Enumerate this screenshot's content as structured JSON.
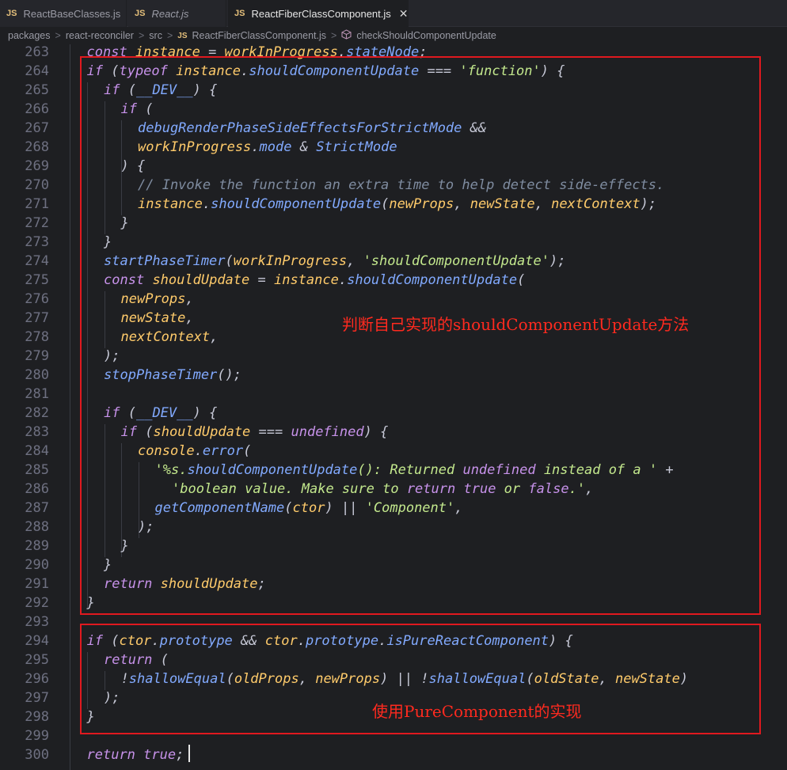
{
  "tabs": [
    {
      "badge": "JS",
      "label": "ReactBaseClasses.js"
    },
    {
      "badge": "JS",
      "label": "React.js"
    },
    {
      "badge": "JS",
      "label": "ReactFiberClassComponent.js",
      "close": "✕"
    }
  ],
  "breadcrumb": {
    "items": [
      "packages",
      "react-reconciler",
      "src"
    ],
    "file_badge": "JS",
    "file": "ReactFiberClassComponent.js",
    "symbol": "checkShouldComponentUpdate",
    "separator": ">"
  },
  "line_numbers": [
    "263",
    "264",
    "265",
    "266",
    "267",
    "268",
    "269",
    "270",
    "271",
    "272",
    "273",
    "274",
    "275",
    "276",
    "277",
    "278",
    "279",
    "280",
    "281",
    "282",
    "283",
    "284",
    "285",
    "286",
    "287",
    "288",
    "289",
    "290",
    "291",
    "292",
    "293",
    "294",
    "295",
    "296",
    "297",
    "298",
    "299",
    "300"
  ],
  "annotations": {
    "note1": "判断自己实现的shouldComponentUpdate方法",
    "note2": "使用PureComponent的实现"
  },
  "colors": {
    "annotation": "#e0191f",
    "background": "#1e1f22"
  },
  "code": [
    [
      "const instance = workInProgress.stateNode;"
    ],
    [
      "if (typeof instance.shouldComponentUpdate === 'function') {"
    ],
    [
      "if (__DEV__) {"
    ],
    [
      "if ("
    ],
    [
      "debugRenderPhaseSideEffectsForStrictMode &&"
    ],
    [
      "workInProgress.mode & StrictMode"
    ],
    [
      ") {"
    ],
    [
      "// Invoke the function an extra time to help detect side-effects."
    ],
    [
      "instance.shouldComponentUpdate(newProps, newState, nextContext);"
    ],
    [
      "}"
    ],
    [
      "}"
    ],
    [
      "startPhaseTimer(workInProgress, 'shouldComponentUpdate');"
    ],
    [
      "const shouldUpdate = instance.shouldComponentUpdate("
    ],
    [
      "newProps,"
    ],
    [
      "newState,"
    ],
    [
      "nextContext,"
    ],
    [
      ");"
    ],
    [
      "stopPhaseTimer();"
    ],
    [
      ""
    ],
    [
      "if (__DEV__) {"
    ],
    [
      "if (shouldUpdate === undefined) {"
    ],
    [
      "console.error("
    ],
    [
      "'%s.shouldComponentUpdate(): Returned undefined instead of a ' +"
    ],
    [
      "'boolean value. Make sure to return true or false.',"
    ],
    [
      "getComponentName(ctor) || 'Component',"
    ],
    [
      ");"
    ],
    [
      "}"
    ],
    [
      "}"
    ],
    [
      "return shouldUpdate;"
    ],
    [
      "}"
    ],
    [
      ""
    ],
    [
      "if (ctor.prototype && ctor.prototype.isPureReactComponent) {"
    ],
    [
      "return ("
    ],
    [
      "!shallowEqual(oldProps, newProps) || !shallowEqual(oldState, newState)"
    ],
    [
      ");"
    ],
    [
      "}"
    ],
    [
      ""
    ],
    [
      "return true;"
    ]
  ]
}
